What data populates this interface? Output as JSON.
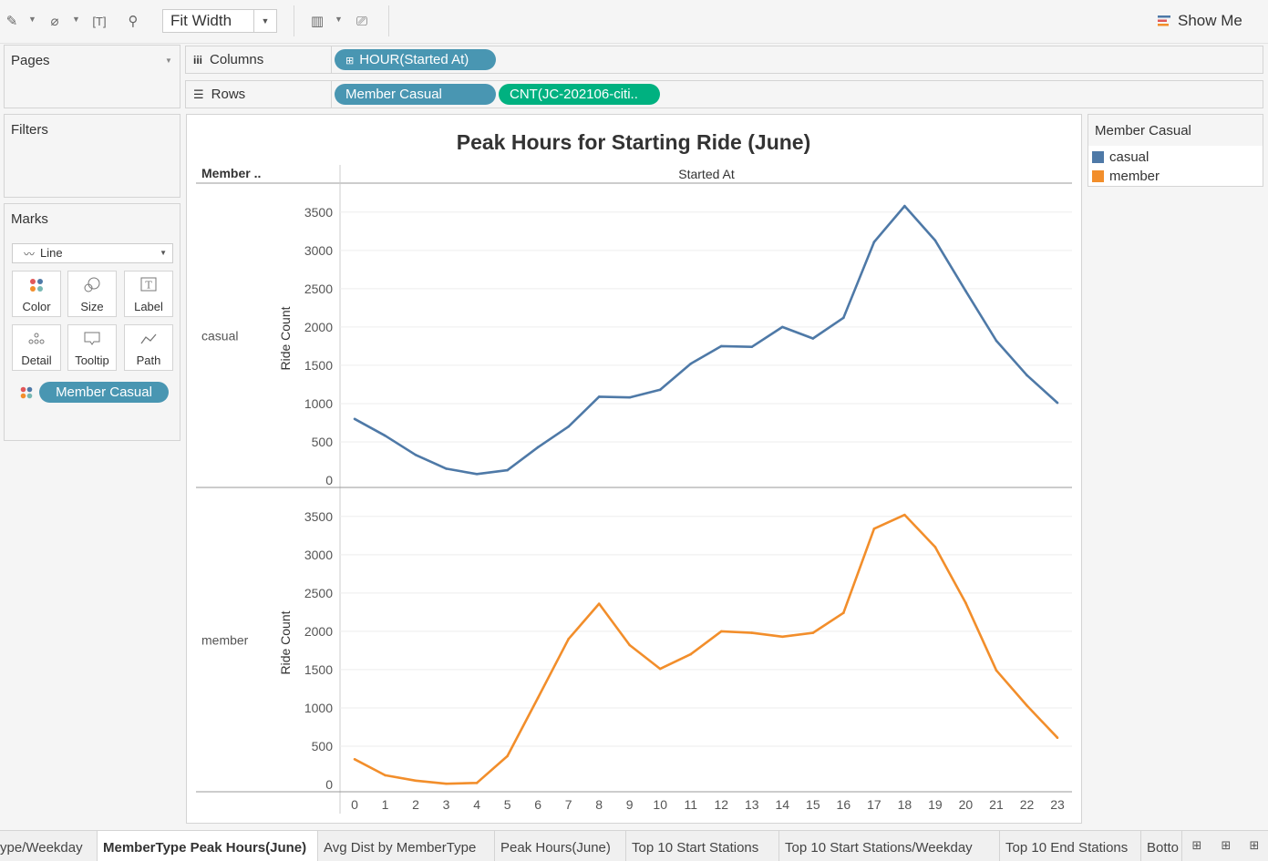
{
  "toolbar": {
    "fit_label": "Fit Width",
    "show_me": "Show Me"
  },
  "panels": {
    "pages": "Pages",
    "filters": "Filters",
    "marks": "Marks",
    "mark_type": "Line",
    "mark_buttons": [
      "Color",
      "Size",
      "Label",
      "Detail",
      "Tooltip",
      "Path"
    ],
    "mark_pill": "Member Casual"
  },
  "shelves": {
    "columns_label": "Columns",
    "rows_label": "Rows",
    "columns_pill": "HOUR(Started At)",
    "rows_pill_1": "Member Casual",
    "rows_pill_2": "CNT(JC-202106-citi.."
  },
  "legend": {
    "title": "Member Casual",
    "items": [
      {
        "label": "casual",
        "color": "#4e79a7"
      },
      {
        "label": "member",
        "color": "#f28e2b"
      }
    ]
  },
  "tabs": [
    "ype/Weekday",
    "MemberType Peak Hours(June)",
    "Avg Dist by MemberType",
    "Peak Hours(June)",
    "Top 10 Start Stations",
    "Top 10 Start Stations/Weekday",
    "Top 10 End Stations",
    "Botto"
  ],
  "chart_data": {
    "type": "line",
    "title": "Peak Hours for Starting Ride (June)",
    "row_header": "Member ..",
    "column_header": "Started At",
    "ylabel": "Ride Count",
    "x": [
      0,
      1,
      2,
      3,
      4,
      5,
      6,
      7,
      8,
      9,
      10,
      11,
      12,
      13,
      14,
      15,
      16,
      17,
      18,
      19,
      20,
      21,
      22,
      23
    ],
    "ylim": [
      0,
      3700
    ],
    "yticks": [
      0,
      500,
      1000,
      1500,
      2000,
      2500,
      3000,
      3500
    ],
    "panes": [
      {
        "name": "casual",
        "color": "#4e79a7",
        "values": [
          800,
          580,
          330,
          150,
          80,
          130,
          430,
          700,
          1090,
          1080,
          1180,
          1520,
          1750,
          1740,
          2000,
          1850,
          2120,
          3110,
          3580,
          3130,
          2470,
          1820,
          1370,
          1010
        ]
      },
      {
        "name": "member",
        "color": "#f28e2b",
        "values": [
          330,
          120,
          50,
          10,
          20,
          370,
          1130,
          1900,
          2360,
          1820,
          1510,
          1700,
          2000,
          1980,
          1930,
          1980,
          2240,
          3340,
          3520,
          3100,
          2370,
          1490,
          1030,
          610
        ]
      }
    ]
  }
}
